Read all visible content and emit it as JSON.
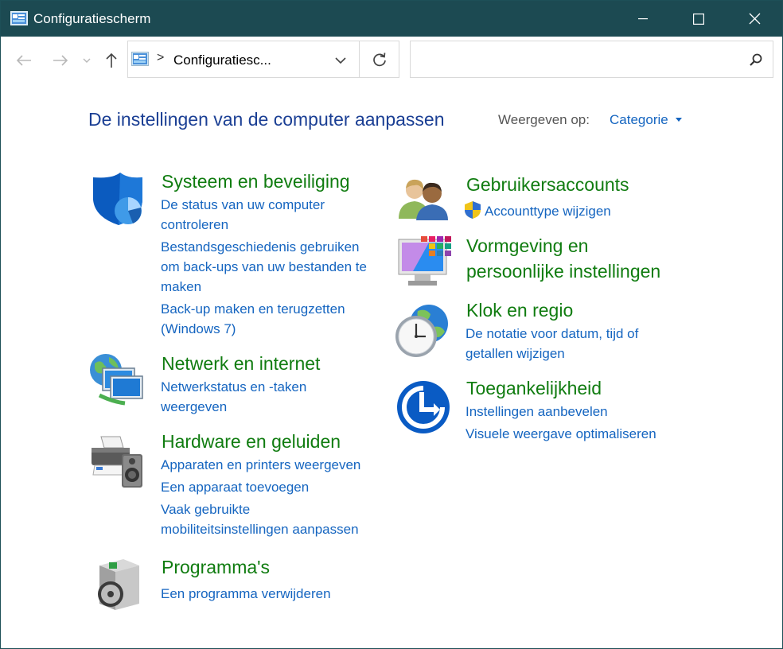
{
  "window": {
    "title": "Configuratiescherm"
  },
  "address": {
    "path_text": "Configuratiesc...",
    "separator": ">"
  },
  "search": {
    "placeholder": ""
  },
  "main": {
    "heading": "De instellingen van de computer aanpassen",
    "view_by_label": "Weergeven op:",
    "view_by_value": "Categorie"
  },
  "categories": {
    "system": {
      "title": "Systeem en beveiliging",
      "links": [
        "De status van uw computer",
        "controleren",
        "Bestandsgeschiedenis gebruiken",
        "om back-ups van uw bestanden te",
        "maken",
        "Back-up maken en terugzetten",
        "(Windows 7)"
      ]
    },
    "network": {
      "title": "Netwerk en internet",
      "links": [
        "Netwerkstatus en -taken",
        "weergeven"
      ]
    },
    "hardware": {
      "title": "Hardware en geluiden",
      "links": [
        "Apparaten en printers weergeven",
        "Een apparaat toevoegen",
        "Vaak gebruikte",
        "mobiliteitsinstellingen aanpassen"
      ]
    },
    "programs": {
      "title": "Programma's",
      "links": [
        "Een programma verwijderen"
      ]
    },
    "users": {
      "title": "Gebruikersaccounts",
      "links": [
        "Accounttype wijzigen"
      ]
    },
    "appearance": {
      "title_line1": "Vormgeving en",
      "title_line2": "persoonlijke instellingen"
    },
    "clock": {
      "title": "Klok en regio",
      "links": [
        "De notatie voor datum, tijd of",
        "getallen wijzigen"
      ]
    },
    "access": {
      "title": "Toegankelijkheid",
      "links": [
        "Instellingen aanbevelen",
        "Visuele weergave optimaliseren"
      ]
    }
  },
  "colors": {
    "titlebar": "#1c4a52",
    "category_title": "#107c10",
    "link": "#1565c0",
    "heading": "#1b3f94"
  }
}
